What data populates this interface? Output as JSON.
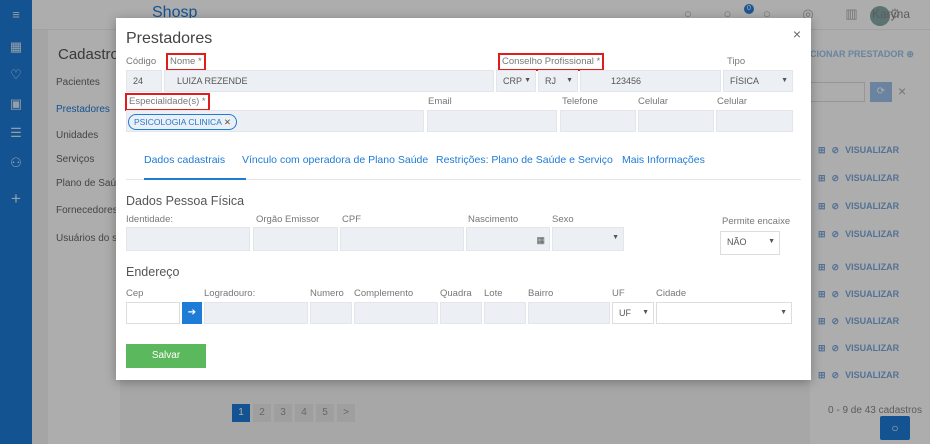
{
  "app": {
    "logo_text": "Shosp",
    "user_name": "Karyna",
    "notification_count": "0"
  },
  "sidebar_bg": {
    "cadastros_title": "Cadastros",
    "items": [
      "Pacientes",
      "Prestadores",
      "Unidades",
      "Serviços",
      "Plano de Saú",
      "Fornecedores",
      "Usuários do s"
    ]
  },
  "list_bg": {
    "add_prestador_label": "CIONAR PRESTADOR",
    "visualizar_label": "VISUALIZAR",
    "pagination": [
      "1",
      "2",
      "3",
      "4",
      "5",
      ">"
    ],
    "count_text": "0 - 9 de 43 cadastros"
  },
  "modal": {
    "title": "Prestadores",
    "close_icon": "×",
    "fields": {
      "codigo_label": "Código",
      "codigo_value": "24",
      "nome_label": "Nome *",
      "nome_value": "LUIZA REZENDE",
      "conselho_label": "Conselho Profissional *",
      "conselho_value": "CRP",
      "conselho_uf": "RJ",
      "conselho_numero": "123456",
      "tipo_label": "Tipo",
      "tipo_value": "FÍSICA",
      "especialidade_label": "Especialidade(s) *",
      "especialidade_chip": "PSICOLOGIA CLINICA",
      "email_label": "Email",
      "telefone_label": "Telefone",
      "celular_label": "Celular",
      "celular2_label": "Celular"
    },
    "tabs": [
      "Dados cadastrais",
      "Vínculo com operadora de Plano Saúde",
      "Restrições: Plano de Saúde e Serviço",
      "Mais Informações"
    ],
    "pessoa_fisica": {
      "section_title": "Dados Pessoa Física",
      "identidade_label": "Identidade:",
      "orgao_label": "Orgão Emissor",
      "cpf_label": "CPF",
      "nascimento_label": "Nascimento",
      "sexo_label": "Sexo",
      "encaixe_label": "Permite encaixe",
      "encaixe_value": "NÃO"
    },
    "endereco": {
      "section_title": "Endereço",
      "cep_label": "Cep",
      "logradouro_label": "Logradouro:",
      "numero_label": "Numero",
      "complemento_label": "Complemento",
      "quadra_label": "Quadra",
      "lote_label": "Lote",
      "bairro_label": "Bairro",
      "uf_label": "UF",
      "uf_value": "UF",
      "cidade_label": "Cidade"
    },
    "save_label": "Salvar"
  },
  "colors": {
    "primary": "#1e7bd6",
    "save_green": "#5cb85c",
    "highlight_red": "#e01c1c"
  }
}
